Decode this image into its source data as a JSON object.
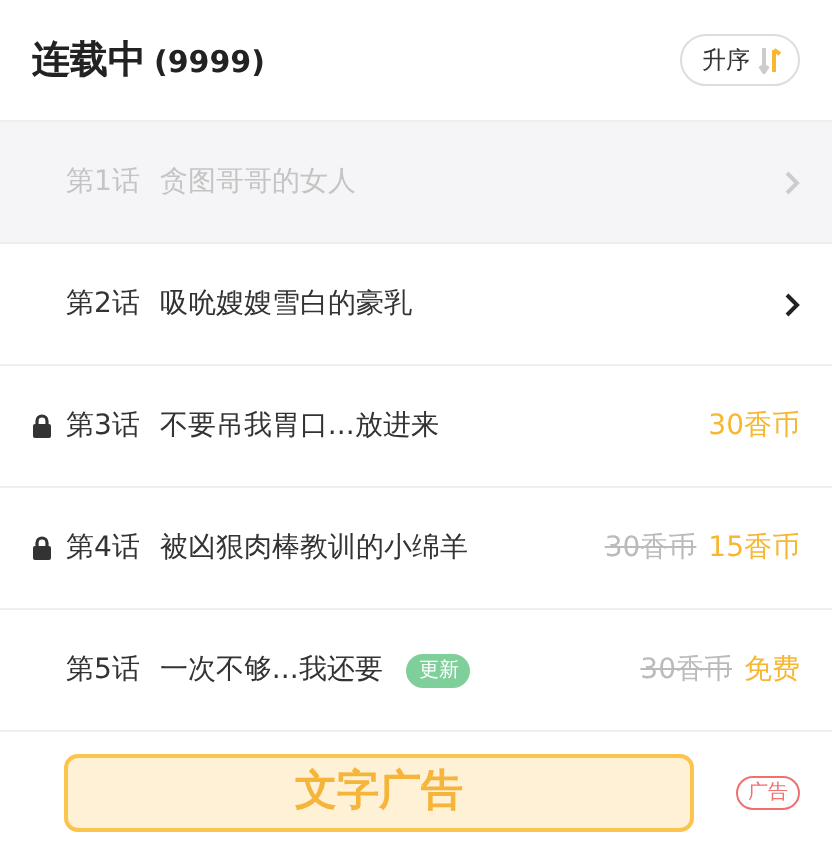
{
  "header": {
    "title": "连载中",
    "count": "(9999)",
    "sort_button": "升序"
  },
  "chapters": [
    {
      "number": "第1话",
      "title": "贪图哥哥的女人",
      "read": true,
      "locked": false,
      "chevron": true
    },
    {
      "number": "第2话",
      "title": "吸吮嫂嫂雪白的豪乳",
      "read": false,
      "locked": false,
      "chevron": true
    },
    {
      "number": "第3话",
      "title": "不要吊我胃口...放进来",
      "read": false,
      "locked": true,
      "chevron": false,
      "price": "30香币"
    },
    {
      "number": "第4话",
      "title": "被凶狠肉棒教训的小绵羊",
      "read": false,
      "locked": true,
      "chevron": false,
      "old_price": "30香币",
      "price": "15香币"
    },
    {
      "number": "第5话",
      "title": "一次不够...我还要",
      "read": false,
      "locked": false,
      "chevron": false,
      "tag": "更新",
      "old_price": "30香币",
      "price": "免费"
    }
  ],
  "ad": {
    "text": "文字广告",
    "label": "广告"
  }
}
